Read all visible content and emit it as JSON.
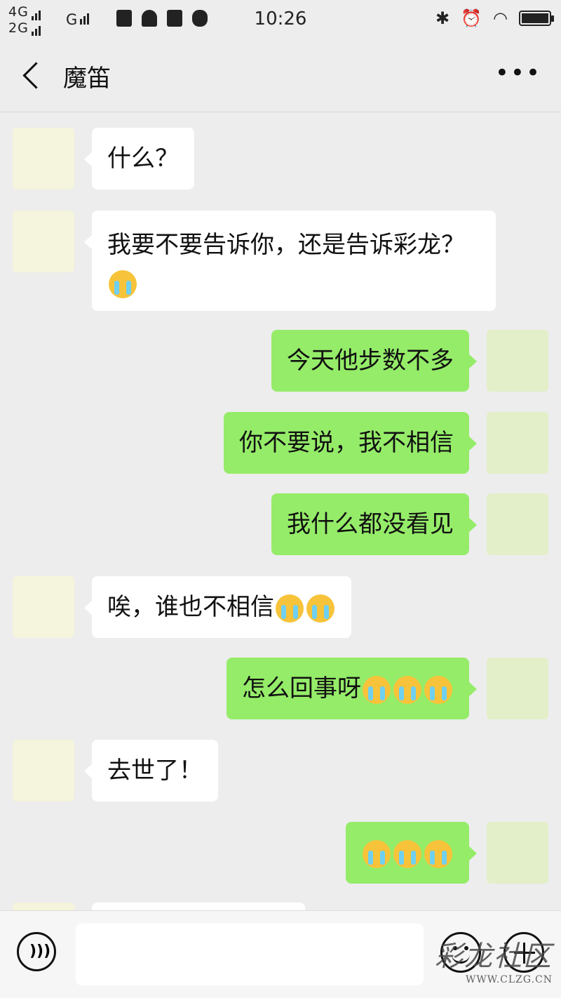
{
  "status_bar": {
    "network_1": "4G",
    "network_2": "2G",
    "network_3": "G",
    "time": "10:26"
  },
  "header": {
    "title": "魔笛",
    "more": "•••"
  },
  "messages": [
    {
      "sender": "friend",
      "text": "什么？"
    },
    {
      "sender": "friend",
      "text": "我要不要告诉你，还是告诉彩龙？",
      "emojis": [
        "crying-face"
      ]
    },
    {
      "sender": "me",
      "text": "今天他步数不多"
    },
    {
      "sender": "me",
      "text": "你不要说，我不相信"
    },
    {
      "sender": "me",
      "text": "我什么都没看见"
    },
    {
      "sender": "friend",
      "text": "唉，谁也不相信",
      "emojis": [
        "crying-face",
        "crying-face"
      ]
    },
    {
      "sender": "me",
      "text": "怎么回事呀",
      "emojis": [
        "crying-face",
        "crying-face",
        "crying-face"
      ]
    },
    {
      "sender": "friend",
      "text": "去世了！"
    },
    {
      "sender": "me",
      "text": "",
      "emojis": [
        "crying-face",
        "crying-face",
        "crying-face"
      ]
    }
  ],
  "colors": {
    "my_bubble": "#95ec69",
    "friend_bubble": "#ffffff",
    "background": "#ededed"
  },
  "watermark": {
    "line1": "彩龙社区",
    "line2": "WWW.CLZG.CN"
  }
}
